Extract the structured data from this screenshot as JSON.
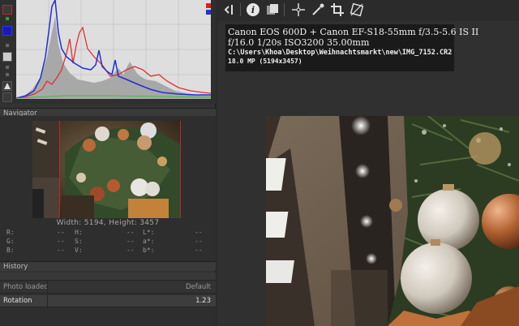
{
  "panels": {
    "navigator_title": "Navigator",
    "history_title": "History"
  },
  "navigator": {
    "dimensions": "Width: 5194, Height: 3457"
  },
  "readout": {
    "rows": [
      {
        "a": "R:",
        "av": "--",
        "b": "H:",
        "bv": "--",
        "c": "L*:",
        "cv": "--"
      },
      {
        "a": "G:",
        "av": "--",
        "b": "S:",
        "bv": "--",
        "c": "a*:",
        "cv": "--"
      },
      {
        "a": "B:",
        "av": "--",
        "b": "V:",
        "bv": "--",
        "c": "b*:",
        "cv": "--"
      }
    ]
  },
  "history": {
    "rows": [
      {
        "label": "Photo loaded",
        "value": "Default"
      },
      {
        "label": "Rotation",
        "value": "1.23"
      }
    ]
  },
  "info": {
    "camera_lens": "Canon EOS 600D + Canon EF-S18-55mm f/3.5-5.6 IS II",
    "aperture": "f/16.0",
    "shutter": "1/20s",
    "iso": "ISO3200",
    "focal": "35.00mm",
    "path": "C:\\Users\\Khoa\\Desktop\\Weihnachtsmarkt\\new\\IMG_7152.CR2",
    "megapixels": "18.0 MP (5194x3457)"
  },
  "toolbar": {
    "icons": [
      "collapse-left-icon",
      "info-icon",
      "before-after-icon",
      "hand-icon",
      "color-picker-icon",
      "crop-icon",
      "straighten-icon"
    ]
  },
  "colors": {
    "red": "#e03030",
    "blue": "#2030d0",
    "green": "#20c020",
    "luminance": "#a0a0a0",
    "frame": "#c0262a"
  }
}
